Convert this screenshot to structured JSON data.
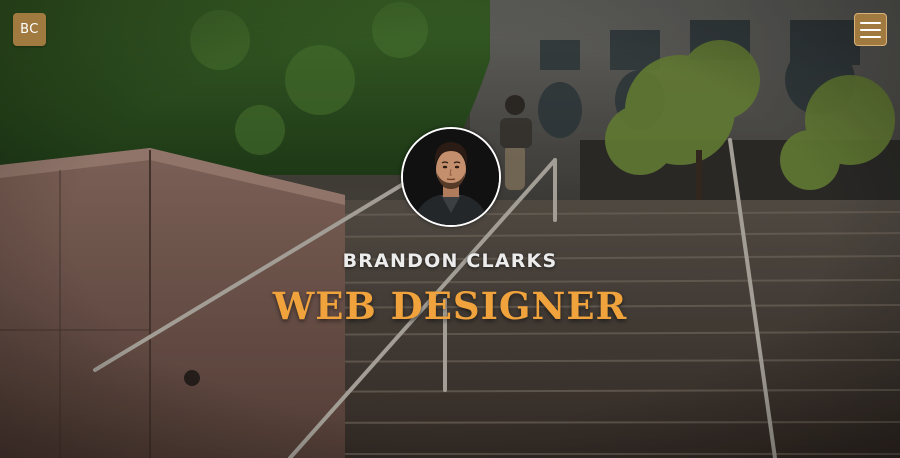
{
  "header": {
    "logo_text": "BC",
    "menu_icon": "hamburger-icon"
  },
  "hero": {
    "name": "BRANDON CLARKS",
    "title": "WEB DESIGNER",
    "avatar_alt": "profile-photo"
  },
  "colors": {
    "accent": "#a07a3f",
    "title": "#f0a33c",
    "name": "#ececec"
  }
}
